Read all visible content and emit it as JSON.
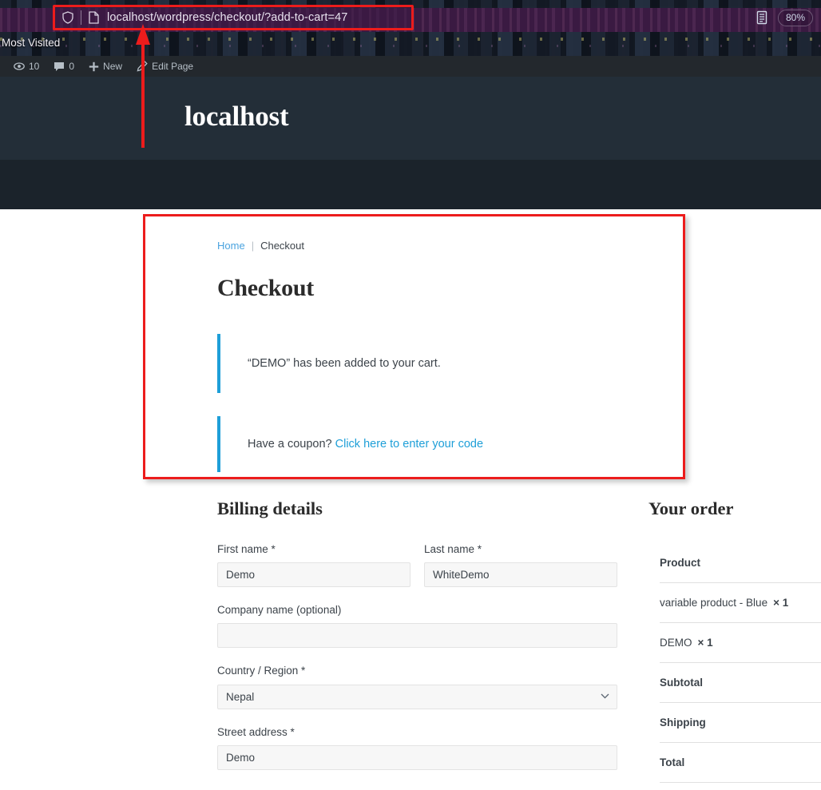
{
  "browser": {
    "url": "localhost/wordpress/checkout/?add-to-cart=47",
    "zoom_level": "80%",
    "bookmark_label": "Most Visited",
    "shield_icon": "shield-icon",
    "page_icon": "page-icon",
    "reader_icon": "reader-mode-icon"
  },
  "adminbar": {
    "updates_icon": "updates-icon",
    "updates_count": "10",
    "comments_icon": "comments-icon",
    "comments_count": "0",
    "new_icon": "plus-icon",
    "new_label": "New",
    "edit_icon": "pencil-icon",
    "edit_label": "Edit Page"
  },
  "site": {
    "title": "localhost"
  },
  "breadcrumb": {
    "home": "Home",
    "separator": "|",
    "current": "Checkout"
  },
  "page": {
    "title": "Checkout"
  },
  "notices": {
    "added_to_cart": "“DEMO” has been added to your cart.",
    "coupon_prompt": "Have a coupon?",
    "coupon_link": "Click here to enter your code"
  },
  "billing": {
    "heading": "Billing details",
    "fields": [
      {
        "label": "First name *",
        "value": "Demo",
        "type": "text"
      },
      {
        "label": "Last name *",
        "value": "WhiteDemo",
        "type": "text"
      },
      {
        "label": "Company name (optional)",
        "value": "",
        "type": "text"
      },
      {
        "label": "Country / Region *",
        "value": "Nepal",
        "type": "select"
      },
      {
        "label": "Street address *",
        "value": "Demo",
        "type": "text"
      }
    ]
  },
  "order": {
    "heading": "Your order",
    "column_header": "Product",
    "items": [
      {
        "name": "variable product - Blue",
        "qty": "× 1"
      },
      {
        "name": "DEMO",
        "qty": "× 1"
      }
    ],
    "totals": [
      {
        "label": "Subtotal"
      },
      {
        "label": "Shipping"
      },
      {
        "label": "Total"
      }
    ]
  },
  "colors": {
    "annotation": "#ec1c1c",
    "notice_accent": "#1e9fd8",
    "link": "#4aa3df",
    "header_bg": "#232e38",
    "nav_bg": "#1b232b",
    "adminbar_bg": "#23282d"
  }
}
